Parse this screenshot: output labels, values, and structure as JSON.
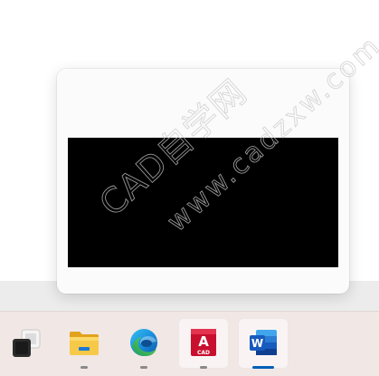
{
  "preview": {
    "window_title": ""
  },
  "watermark": {
    "line1": "CAD自学网",
    "line2": "www.cadzxw.com"
  },
  "taskbar": {
    "items": [
      {
        "name": "Task View",
        "icon": "task-view-icon",
        "indicator": "none"
      },
      {
        "name": "File Explorer",
        "icon": "folder-icon",
        "indicator": "dot"
      },
      {
        "name": "Microsoft Edge",
        "icon": "edge-icon",
        "indicator": "dot"
      },
      {
        "name": "AutoCAD",
        "icon": "autocad-icon",
        "indicator": "dot",
        "badge_letter": "A",
        "badge_text": "CAD"
      },
      {
        "name": "Microsoft Word",
        "icon": "word-icon",
        "indicator": "bar",
        "badge_letter": "W"
      }
    ]
  },
  "colors": {
    "taskbar_bg": "#f1e7e5",
    "accent": "#005fb8",
    "autocad_red": "#c8102e",
    "word_blue": "#185abd",
    "folder_yellow": "#f7c948"
  }
}
